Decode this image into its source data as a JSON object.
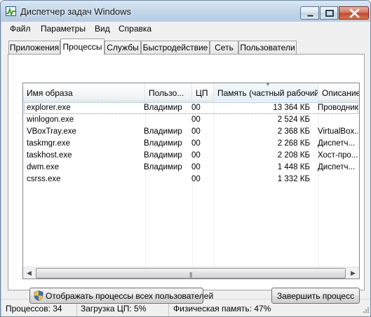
{
  "window": {
    "title": "Диспетчер задач Windows",
    "accent_color": "#c5452b"
  },
  "menu": {
    "items": [
      {
        "label": "Файл"
      },
      {
        "label": "Параметры"
      },
      {
        "label": "Вид"
      },
      {
        "label": "Справка"
      }
    ]
  },
  "tabs": [
    {
      "label": "Приложения",
      "active": false
    },
    {
      "label": "Процессы",
      "active": true
    },
    {
      "label": "Службы",
      "active": false
    },
    {
      "label": "Быстродействие",
      "active": false
    },
    {
      "label": "Сеть",
      "active": false
    },
    {
      "label": "Пользователи",
      "active": false
    }
  ],
  "table": {
    "columns": [
      {
        "label": "Имя образа"
      },
      {
        "label": "Пользо..."
      },
      {
        "label": "ЦП"
      },
      {
        "label": "Память (частный рабочий набор)",
        "sorted": true
      },
      {
        "label": "Описание"
      }
    ],
    "rows": [
      {
        "name": "explorer.exe",
        "user": "Владимир",
        "cpu": "00",
        "memory": "13 364 КБ",
        "description": "Проводник",
        "selected": true
      },
      {
        "name": "winlogon.exe",
        "user": "",
        "cpu": "00",
        "memory": "2 524 КБ",
        "description": "",
        "selected": false
      },
      {
        "name": "VBoxTray.exe",
        "user": "Владимир",
        "cpu": "00",
        "memory": "2 368 КБ",
        "description": "VirtualBox...",
        "selected": false
      },
      {
        "name": "taskmgr.exe",
        "user": "Владимир",
        "cpu": "00",
        "memory": "2 268 КБ",
        "description": "Диспетч...",
        "selected": false
      },
      {
        "name": "taskhost.exe",
        "user": "Владимир",
        "cpu": "00",
        "memory": "2 208 КБ",
        "description": "Хост-про...",
        "selected": false
      },
      {
        "name": "dwm.exe",
        "user": "Владимир",
        "cpu": "00",
        "memory": "1 448 КБ",
        "description": "Диспетч...",
        "selected": false
      },
      {
        "name": "csrss.exe",
        "user": "",
        "cpu": "00",
        "memory": "1 332 КБ",
        "description": "",
        "selected": false
      }
    ],
    "hscroll_grip": "|||"
  },
  "buttons": {
    "show_all": "Отображать процессы всех пользователей",
    "end_process": "Завершить процесс"
  },
  "status": {
    "processes": "Процессов: 34",
    "cpu": "Загрузка ЦП: 5%",
    "memory": "Физическая память: 47%"
  }
}
